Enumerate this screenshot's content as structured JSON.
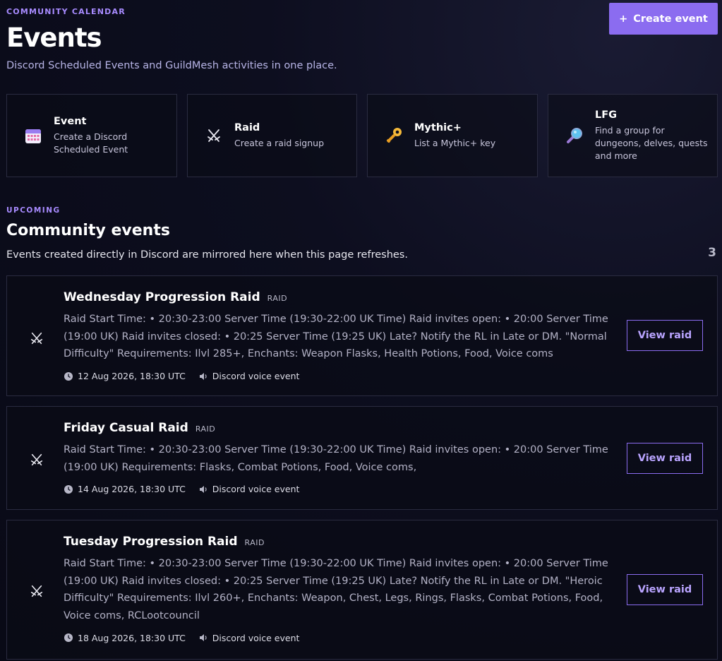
{
  "header": {
    "eyebrow": "COMMUNITY CALENDAR",
    "title": "Events",
    "subtitle": "Discord Scheduled Events and GuildMesh activities in one place.",
    "create_label": "Create event",
    "create_icon": "+"
  },
  "quick_actions": [
    {
      "title": "Event",
      "desc_line1": "Create a Discord",
      "desc_line2": "Scheduled Event",
      "icon": "calendar-icon"
    },
    {
      "title": "Raid",
      "desc_line1": "Create a raid signup",
      "icon": "crossed-swords-icon"
    },
    {
      "title": "Mythic+",
      "desc_line1": "List a Mythic+ key",
      "icon": "key-icon"
    },
    {
      "title": "LFG",
      "desc_line1": "Find a group for",
      "desc_line2": "dungeons, delves, quests",
      "desc_line3": "and more",
      "icon": "magnifier-icon"
    }
  ],
  "upcoming": {
    "eyebrow": "UPCOMING",
    "title": "Community events",
    "desc": "Events created directly in Discord are mirrored here when this page refreshes.",
    "count": "3"
  },
  "events": [
    {
      "title": "Wednesday Progression Raid",
      "tag": "RAID",
      "desc": "Raid Start Time: • 20:30-23:00 Server Time (19:30-22:00 UK Time) Raid invites open: • 20:00 Server Time (19:00 UK) Raid invites closed: • 20:25 Server Time (19:25 UK) Late? Notify the RL in Late or DM. \"Normal Difficulty\" Requirements: Ilvl 285+, Enchants: Weapon Flasks, Health Potions, Food, Voice coms",
      "date": "12 Aug 2026, 18:30 UTC",
      "location": "Discord voice event",
      "button": "View raid"
    },
    {
      "title": "Friday Casual Raid",
      "tag": "RAID",
      "desc": "Raid Start Time: • 20:30-23:00 Server Time (19:30-22:00 UK Time) Raid invites open: • 20:00 Server Time (19:00 UK) Requirements: Flasks, Combat Potions, Food, Voice coms,",
      "date": "14 Aug 2026, 18:30 UTC",
      "location": "Discord voice event",
      "button": "View raid"
    },
    {
      "title": "Tuesday Progression Raid",
      "tag": "RAID",
      "desc": "Raid Start Time: • 20:30-23:00 Server Time (19:30-22:00 UK Time) Raid invites open: • 20:00 Server Time (19:00 UK) Raid invites closed: • 20:25 Server Time (19:25 UK) Late? Notify the RL in Late or DM. \"Heroic Difficulty\" Requirements: Ilvl 260+, Enchants: Weapon, Chest, Legs, Rings, Flasks, Combat Potions, Food, Voice coms, RCLootcouncil",
      "date": "18 Aug 2026, 18:30 UTC",
      "location": "Discord voice event",
      "button": "View raid"
    }
  ],
  "colors": {
    "accent": "#8b6cf0",
    "accent_text": "#a88bff",
    "background": "#0b0c1a",
    "card_border": "#2a2b40"
  }
}
